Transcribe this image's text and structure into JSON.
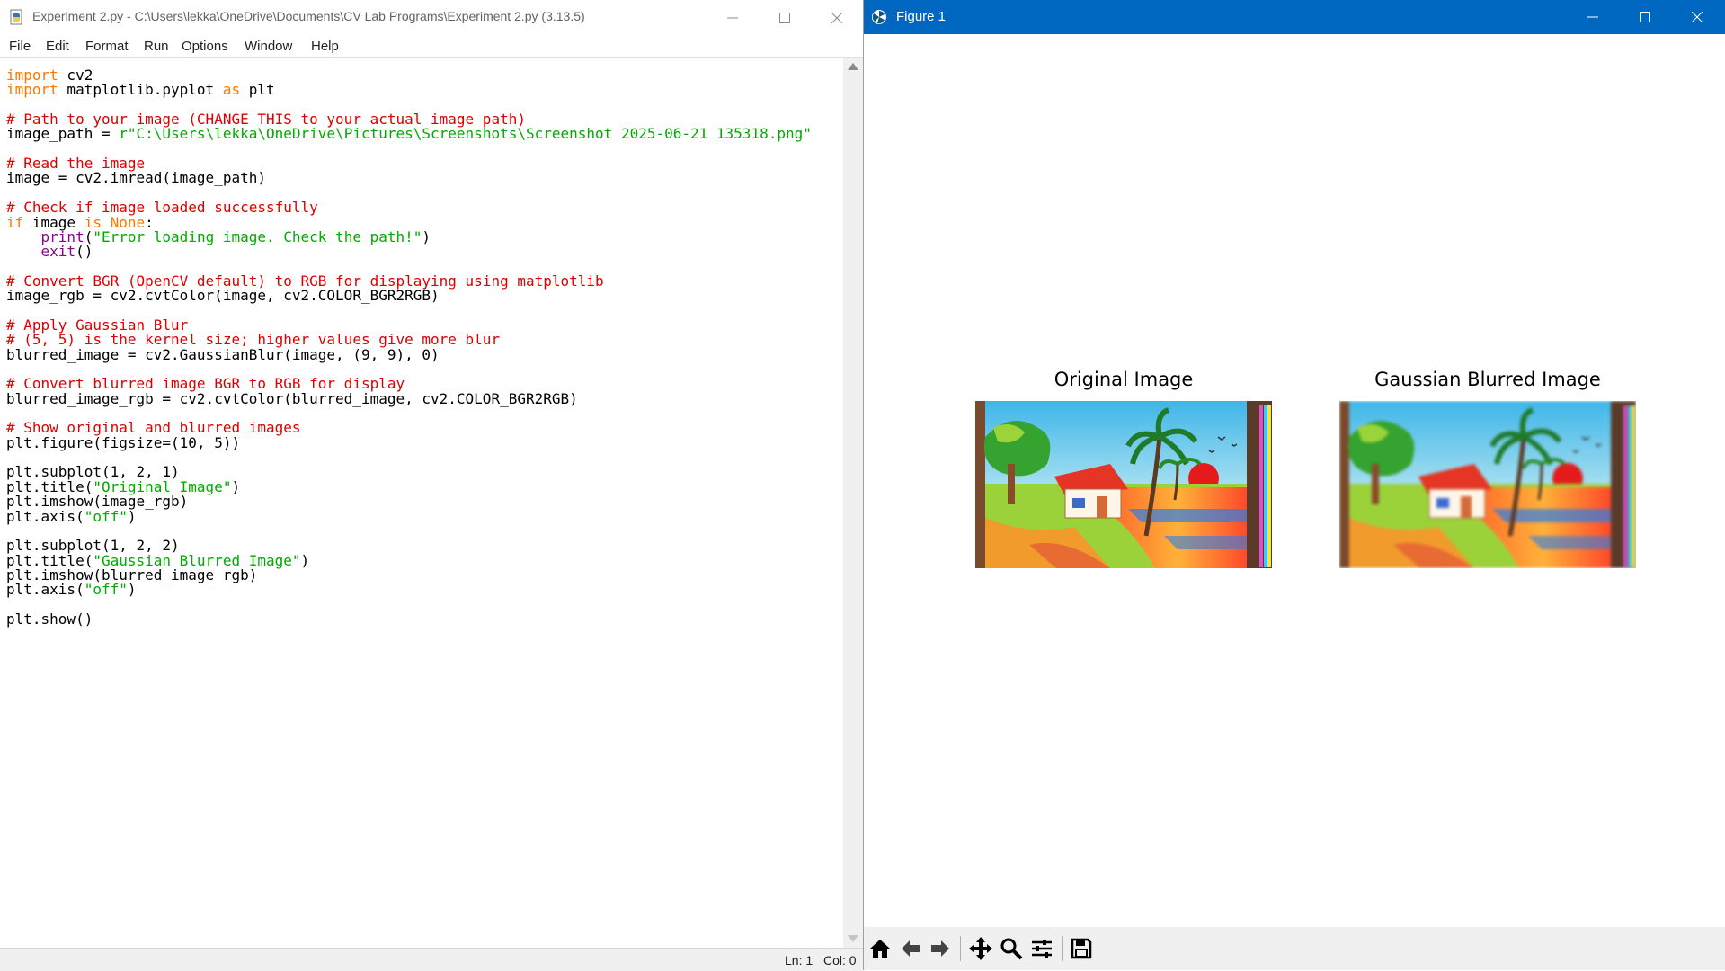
{
  "idle": {
    "title": "Experiment 2.py - C:\\Users\\lekka\\OneDrive\\Documents\\CV Lab Programs\\Experiment 2.py (3.13.5)",
    "menu": [
      "File",
      "Edit",
      "Format",
      "Run",
      "Options",
      "Window",
      "Help"
    ],
    "code_lines": [
      [
        [
          "kw",
          "import"
        ],
        [
          "n",
          " cv2"
        ]
      ],
      [
        [
          "kw",
          "import"
        ],
        [
          "n",
          " matplotlib.pyplot "
        ],
        [
          "kw",
          "as"
        ],
        [
          "n",
          " plt"
        ]
      ],
      [],
      [
        [
          "com",
          "# Path to your image (CHANGE THIS to your actual image path)"
        ]
      ],
      [
        [
          "n",
          "image_path = "
        ],
        [
          "str",
          "r\"C:\\Users\\lekka\\OneDrive\\Pictures\\Screenshots\\Screenshot 2025-06-21 135318.png\""
        ]
      ],
      [],
      [
        [
          "com",
          "# Read the image"
        ]
      ],
      [
        [
          "n",
          "image = cv2.imread(image_path)"
        ]
      ],
      [],
      [
        [
          "com",
          "# Check if image loaded successfully"
        ]
      ],
      [
        [
          "kw",
          "if"
        ],
        [
          "n",
          " image "
        ],
        [
          "kw",
          "is"
        ],
        [
          "n",
          " "
        ],
        [
          "kw",
          "None"
        ],
        [
          "n",
          ":"
        ]
      ],
      [
        [
          "n",
          "    "
        ],
        [
          "bi",
          "print"
        ],
        [
          "n",
          "("
        ],
        [
          "str",
          "\"Error loading image. Check the path!\""
        ],
        [
          "n",
          ")"
        ]
      ],
      [
        [
          "n",
          "    "
        ],
        [
          "bi",
          "exit"
        ],
        [
          "n",
          "()"
        ]
      ],
      [],
      [
        [
          "com",
          "# Convert BGR (OpenCV default) to RGB for displaying using matplotlib"
        ]
      ],
      [
        [
          "n",
          "image_rgb = cv2.cvtColor(image, cv2.COLOR_BGR2RGB)"
        ]
      ],
      [],
      [
        [
          "com",
          "# Apply Gaussian Blur"
        ]
      ],
      [
        [
          "com",
          "# (5, 5) is the kernel size; higher values give more blur"
        ]
      ],
      [
        [
          "n",
          "blurred_image = cv2.GaussianBlur(image, (9, 9), 0)"
        ]
      ],
      [],
      [
        [
          "com",
          "# Convert blurred image BGR to RGB for display"
        ]
      ],
      [
        [
          "n",
          "blurred_image_rgb = cv2.cvtColor(blurred_image, cv2.COLOR_BGR2RGB)"
        ]
      ],
      [],
      [
        [
          "com",
          "# Show original and blurred images"
        ]
      ],
      [
        [
          "n",
          "plt.figure(figsize=(10, 5))"
        ]
      ],
      [],
      [
        [
          "n",
          "plt.subplot(1, 2, 1)"
        ]
      ],
      [
        [
          "n",
          "plt.title("
        ],
        [
          "str",
          "\"Original Image\""
        ],
        [
          "n",
          ")"
        ]
      ],
      [
        [
          "n",
          "plt.imshow(image_rgb)"
        ]
      ],
      [
        [
          "n",
          "plt.axis("
        ],
        [
          "str",
          "\"off\""
        ],
        [
          "n",
          ")"
        ]
      ],
      [],
      [
        [
          "n",
          "plt.subplot(1, 2, 2)"
        ]
      ],
      [
        [
          "n",
          "plt.title("
        ],
        [
          "str",
          "\"Gaussian Blurred Image\""
        ],
        [
          "n",
          ")"
        ]
      ],
      [
        [
          "n",
          "plt.imshow(blurred_image_rgb)"
        ]
      ],
      [
        [
          "n",
          "plt.axis("
        ],
        [
          "str",
          "\"off\""
        ],
        [
          "n",
          ")"
        ]
      ],
      [],
      [
        [
          "n",
          "plt.show()"
        ]
      ]
    ],
    "status_line": "Ln: 1",
    "status_col": "Col: 0",
    "colors": {
      "keyword": "#ff7700",
      "comment": "#dd0000",
      "string": "#00aa00",
      "builtin": "#900090"
    }
  },
  "figure": {
    "title": "Figure 1",
    "titlebar_color": "#0067c0",
    "subplots": [
      {
        "title": "Original Image",
        "image": "painting-original"
      },
      {
        "title": "Gaussian Blurred Image",
        "image": "painting-blurred"
      }
    ],
    "toolbar_icons": [
      "home-icon",
      "back-arrow-icon",
      "forward-arrow-icon",
      "pan-icon",
      "zoom-icon",
      "configure-subplots-icon",
      "save-icon"
    ]
  }
}
